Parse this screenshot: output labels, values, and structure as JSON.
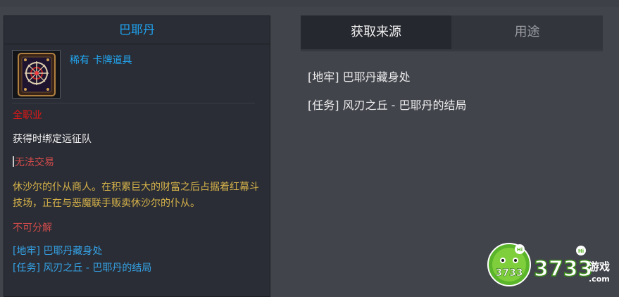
{
  "item": {
    "name": "巴耶丹",
    "rarity_type": "稀有 卡牌道具",
    "class": "全职业",
    "bind": "获得时绑定远征队",
    "trade": "无法交易",
    "description": "休沙尔的仆从商人。在积累巨大的财富之后占据着红幕斗技场，正在与恶魔联手贩卖休沙尔的仆从。",
    "disassemble": "不可分解",
    "sources": [
      "[地牢] 巴耶丹藏身处",
      "[任务] 风刃之丘 - 巴耶丹的结局"
    ],
    "icon": "card-icon"
  },
  "tabs": [
    {
      "label": "获取来源",
      "active": true
    },
    {
      "label": "用途",
      "active": false
    }
  ],
  "acquire_list": [
    "[地牢] 巴耶丹藏身处",
    "[任务] 风刃之丘 - 巴耶丹的结局"
  ],
  "watermark": {
    "text1": "3733",
    "text2": "3733",
    "text3": "游戏",
    "text4": ".com",
    "hi": "Hi"
  },
  "colors": {
    "title_blue": "#1fa3f1",
    "red": "#e01818",
    "gold": "#d6b24a",
    "link_blue": "#35a3e8"
  }
}
